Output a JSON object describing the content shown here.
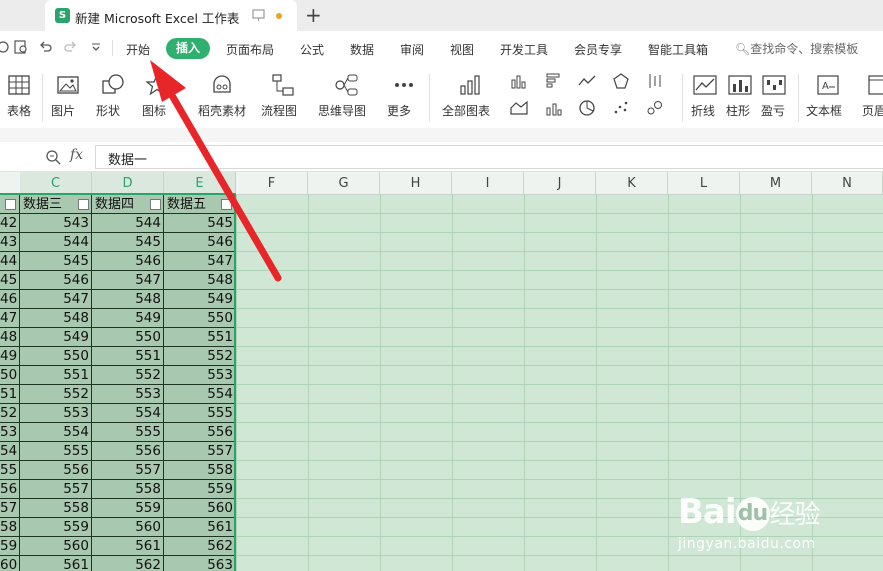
{
  "tab": {
    "logo": "S",
    "title": "新建 Microsoft Excel 工作表",
    "new_tab": "+",
    "unsaved_color": "#f0a020"
  },
  "menu": {
    "start": "开始",
    "insert": "插入",
    "page_layout": "页面布局",
    "formula": "公式",
    "data": "数据",
    "review": "审阅",
    "view": "视图",
    "developer": "开发工具",
    "member": "会员专享",
    "smart_tools": "智能工具箱",
    "search": "查找命令、搜索模板"
  },
  "toolbar": {
    "table": "表格",
    "picture": "图片",
    "shape": "形状",
    "icon": "图标",
    "daoke": "稻壳素材",
    "flowchart": "流程图",
    "mindmap": "思维导图",
    "more": "更多",
    "all_charts": "全部图表",
    "sparkline_line": "折线",
    "sparkline_bar": "柱形",
    "sparkline_winloss": "盈亏",
    "textbox": "文本框",
    "header_footer": "页眉"
  },
  "formula": {
    "fx": "fx",
    "value": "数据一"
  },
  "grid": {
    "columns": [
      "C",
      "D",
      "E",
      "F",
      "G",
      "H",
      "I",
      "J",
      "K",
      "L",
      "M",
      "N"
    ],
    "headers": {
      "partial": "",
      "c": "数据三",
      "d": "数据四",
      "e": "数据五"
    },
    "rows": [
      [
        "42",
        "543",
        "544",
        "545"
      ],
      [
        "43",
        "544",
        "545",
        "546"
      ],
      [
        "44",
        "545",
        "546",
        "547"
      ],
      [
        "45",
        "546",
        "547",
        "548"
      ],
      [
        "46",
        "547",
        "548",
        "549"
      ],
      [
        "47",
        "548",
        "549",
        "550"
      ],
      [
        "48",
        "549",
        "550",
        "551"
      ],
      [
        "49",
        "550",
        "551",
        "552"
      ],
      [
        "50",
        "551",
        "552",
        "553"
      ],
      [
        "51",
        "552",
        "553",
        "554"
      ],
      [
        "52",
        "553",
        "554",
        "555"
      ],
      [
        "53",
        "554",
        "555",
        "556"
      ],
      [
        "54",
        "555",
        "556",
        "557"
      ],
      [
        "55",
        "556",
        "557",
        "558"
      ],
      [
        "56",
        "557",
        "558",
        "559"
      ],
      [
        "57",
        "558",
        "559",
        "560"
      ],
      [
        "58",
        "559",
        "560",
        "561"
      ],
      [
        "59",
        "560",
        "561",
        "562"
      ],
      [
        "60",
        "561",
        "562",
        "563"
      ]
    ]
  },
  "colors": {
    "accent": "#2aa46d",
    "insert_pill": "#2fb06e",
    "arrow": "#e8262a",
    "grid_bg": "#cfe7d4",
    "data_bg": "#a9c8b0"
  },
  "watermark": {
    "brand": "Bai",
    "brand2": "du",
    "suffix": "经验",
    "url": "jingyan.baidu.com"
  }
}
